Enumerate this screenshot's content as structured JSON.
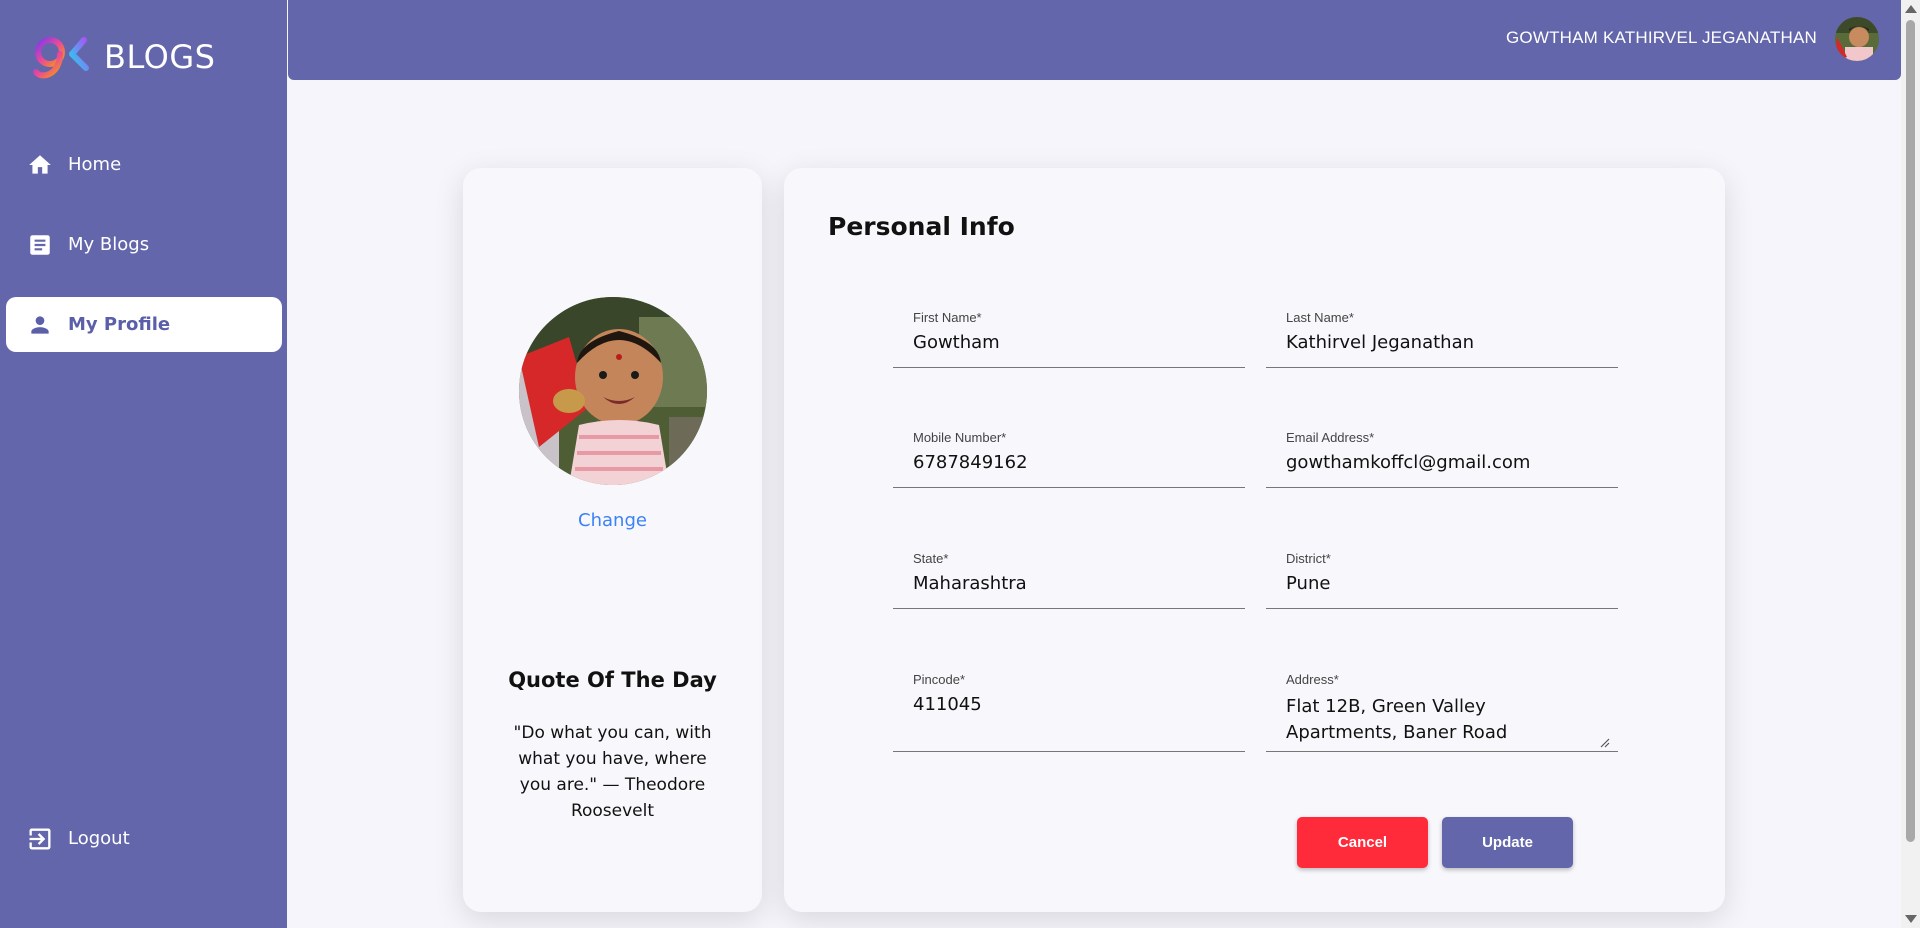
{
  "brand": {
    "title": "BLOGS"
  },
  "sidebar": {
    "items": [
      {
        "label": "Home",
        "icon": "home-icon"
      },
      {
        "label": "My Blogs",
        "icon": "article-icon"
      },
      {
        "label": "My Profile",
        "icon": "person-icon",
        "active": true
      }
    ],
    "logout_label": "Logout"
  },
  "header": {
    "user_name": "GOWTHAM KATHIRVEL JEGANATHAN"
  },
  "profile_card": {
    "change_label": "Change",
    "quote_title": "Quote Of The Day",
    "quote_text": "\"Do what you can, with what you have, where you are.\" — Theodore Roosevelt"
  },
  "personal_info": {
    "title": "Personal Info",
    "fields": [
      {
        "label": "First Name*",
        "value": "Gowtham"
      },
      {
        "label": "Last Name*",
        "value": "Kathirvel Jeganathan"
      },
      {
        "label": "Mobile Number*",
        "value": "6787849162"
      },
      {
        "label": "Email Address*",
        "value": "gowthamkoffcl@gmail.com"
      },
      {
        "label": "State*",
        "value": "Maharashtra"
      },
      {
        "label": "District*",
        "value": "Pune"
      },
      {
        "label": "Pincode*",
        "value": "411045"
      },
      {
        "label": "Address*",
        "value": "Flat 12B, Green Valley Apartments, Baner Road"
      }
    ],
    "cancel_label": "Cancel",
    "update_label": "Update"
  },
  "colors": {
    "primary": "#6366aa",
    "cancel": "#ff2b3a",
    "link": "#3b82f6",
    "background": "#f5f5fb"
  }
}
